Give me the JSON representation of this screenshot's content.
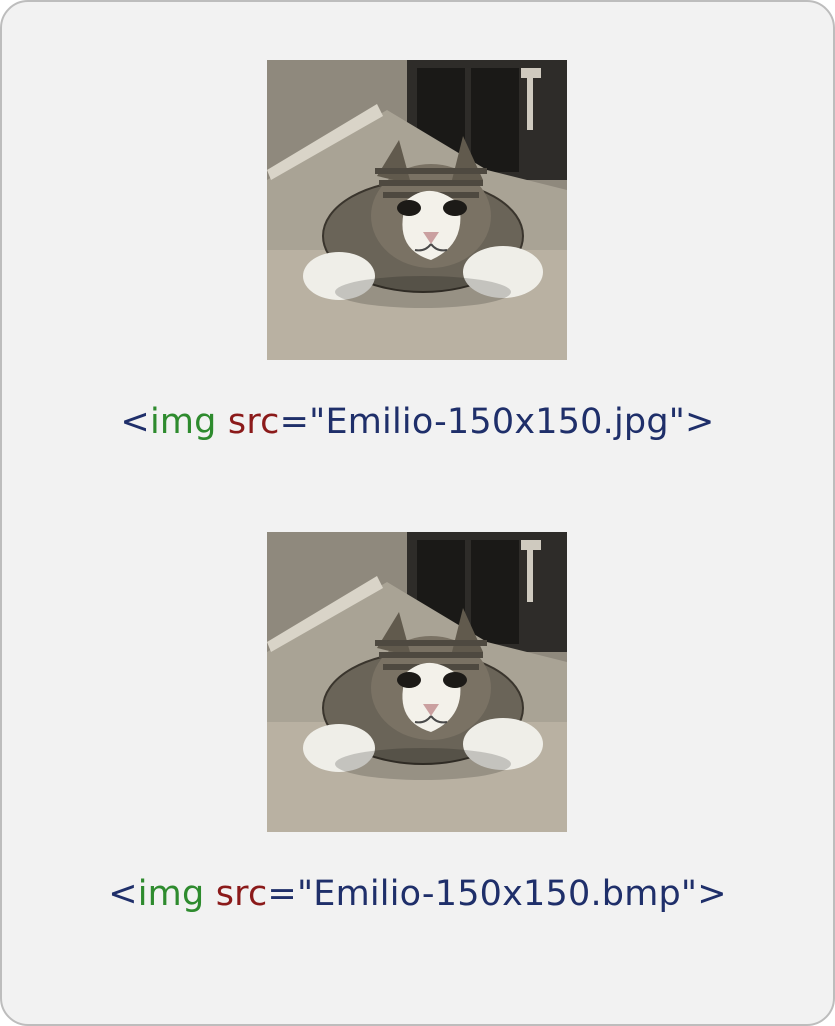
{
  "examples": [
    {
      "image_alt": "cat-photo",
      "code": {
        "open": "<",
        "tag": "img",
        "space": " ",
        "attr": "src",
        "eq": "=",
        "quote1": "\"",
        "value": "Emilio-150x150.jpg",
        "quote2": "\"",
        "close": ">"
      }
    },
    {
      "image_alt": "cat-photo",
      "code": {
        "open": "<",
        "tag": "img",
        "space": " ",
        "attr": "src",
        "eq": "=",
        "quote1": "\"",
        "value": "Emilio-150x150.bmp",
        "quote2": "\"",
        "close": ">"
      }
    }
  ]
}
